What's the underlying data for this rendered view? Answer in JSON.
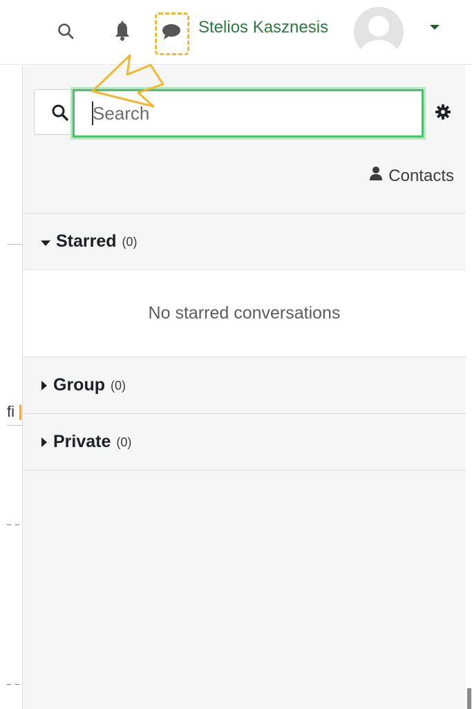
{
  "navbar": {
    "username": "Stelios Kasznesis",
    "icons": [
      "search-icon",
      "bell-icon",
      "message-icon",
      "avatar",
      "chevron-down-icon"
    ]
  },
  "background": {
    "fragment_text": "fi"
  },
  "drawer": {
    "search": {
      "placeholder": "Search"
    },
    "contacts_label": "Contacts",
    "sections": [
      {
        "title": "Starred",
        "count": "(0)",
        "expanded": true,
        "empty_text": "No starred conversations"
      },
      {
        "title": "Group",
        "count": "(0)",
        "expanded": false
      },
      {
        "title": "Private",
        "count": "(0)",
        "expanded": false
      }
    ]
  },
  "colors": {
    "accent_green": "#2b7a3d",
    "focus_border": "#4cbf6a",
    "highlight": "#f0b82e"
  }
}
